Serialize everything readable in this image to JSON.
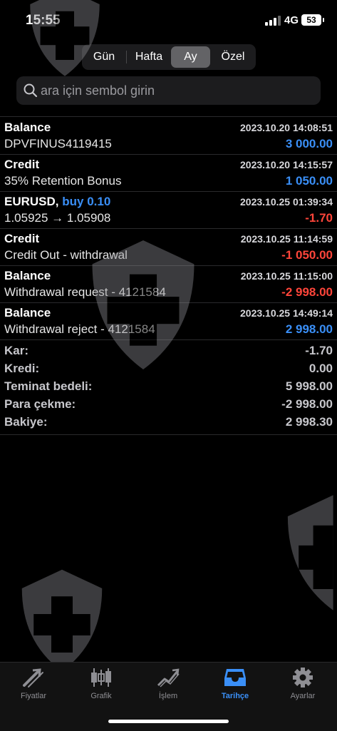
{
  "status_bar": {
    "time": "15:55",
    "network": "4G",
    "battery": "53"
  },
  "period_tabs": [
    {
      "label": "Gün",
      "active": false
    },
    {
      "label": "Hafta",
      "active": false
    },
    {
      "label": "Ay",
      "active": true
    },
    {
      "label": "Özel",
      "active": false
    }
  ],
  "search": {
    "placeholder": "ara için sembol girin",
    "value": ""
  },
  "entries": [
    {
      "title": "Balance",
      "deal": "",
      "date": "2023.10.20 14:08:51",
      "subtitle": "DPVFINUS4119415",
      "amount": "3 000.00",
      "sign": "pos"
    },
    {
      "title": "Credit",
      "deal": "",
      "date": "2023.10.20 14:15:57",
      "subtitle": "35% Retention Bonus",
      "amount": "1 050.00",
      "sign": "pos"
    },
    {
      "title": "EURUSD,",
      "deal": "buy 0.10",
      "date": "2023.10.25 01:39:34",
      "subtitle": "1.05925 → 1.05908",
      "amount": "-1.70",
      "sign": "neg"
    },
    {
      "title": "Credit",
      "deal": "",
      "date": "2023.10.25 11:14:59",
      "subtitle": "Credit Out - withdrawal",
      "amount": "-1 050.00",
      "sign": "neg"
    },
    {
      "title": "Balance",
      "deal": "",
      "date": "2023.10.25 11:15:00",
      "subtitle": "Withdrawal request - 4121584",
      "amount": "-2 998.00",
      "sign": "neg"
    },
    {
      "title": "Balance",
      "deal": "",
      "date": "2023.10.25 14:49:14",
      "subtitle": "Withdrawal reject - 4121584",
      "amount": "2 998.00",
      "sign": "pos"
    }
  ],
  "summary": [
    {
      "label": "Kar:",
      "value": "-1.70"
    },
    {
      "label": "Kredi:",
      "value": "0.00"
    },
    {
      "label": "Teminat bedeli:",
      "value": "5 998.00"
    },
    {
      "label": "Para çekme:",
      "value": "-2 998.00"
    },
    {
      "label": "Bakiye:",
      "value": "2 998.30"
    }
  ],
  "tab_bar": [
    {
      "label": "Fiyatlar",
      "icon": "quotes-arrows-icon",
      "active": false
    },
    {
      "label": "Grafik",
      "icon": "candlestick-chart-icon",
      "active": false
    },
    {
      "label": "İşlem",
      "icon": "trend-line-icon",
      "active": false
    },
    {
      "label": "Tarihçe",
      "icon": "history-tray-icon",
      "active": true
    },
    {
      "label": "Ayarlar",
      "icon": "gear-icon",
      "active": false
    }
  ],
  "colors": {
    "accent": "#3a8ff7",
    "negative": "#ff453a",
    "background": "#000000"
  }
}
